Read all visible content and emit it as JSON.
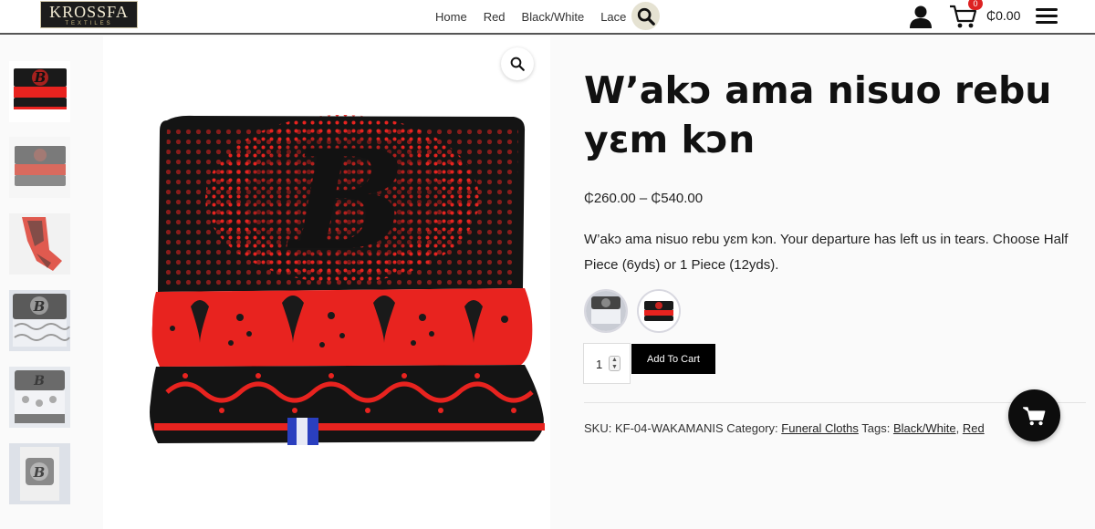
{
  "brand": {
    "logo_main": "KROSSFA",
    "logo_sub": "TEXTILES"
  },
  "nav": {
    "items": [
      {
        "label": "Home"
      },
      {
        "label": "Red"
      },
      {
        "label": "Black/White"
      },
      {
        "label": "Lace"
      }
    ]
  },
  "cart": {
    "count": "0",
    "total": "₵0.00"
  },
  "product": {
    "title": "W’akɔ ama nisuo rebu yɛm kɔn",
    "price": "₵260.00 – ₵540.00",
    "description": "W’akɔ ama nisuo rebu yɛm kɔn. Your departure has left us in tears. Choose Half Piece (6yds) or 1 Piece (12yds).",
    "quantity": "1",
    "add_to_cart": "Add To Cart",
    "sku_label": "SKU:",
    "sku": "KF-04-WAKAMANIS",
    "category_label": "Category:",
    "category": "Funeral Cloths",
    "tags_label": "Tags:",
    "tags": [
      "Black/White",
      "Red"
    ],
    "tag_separator": ","
  },
  "images": {
    "main_letter": "B",
    "thumbnail_count": 6
  },
  "colors": {
    "accent_red": "#e8231f",
    "dark": "#111111",
    "search_bg": "#e5e2d2",
    "badge_red": "#dd2222"
  }
}
